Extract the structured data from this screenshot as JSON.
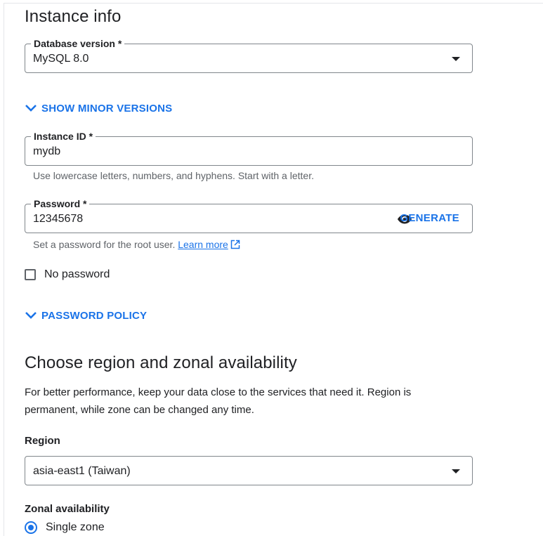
{
  "instance_info": {
    "title": "Instance info",
    "database_version": {
      "label": "Database version *",
      "value": "MySQL 8.0"
    },
    "show_minor_versions": "SHOW MINOR VERSIONS",
    "instance_id": {
      "label": "Instance ID *",
      "value": "mydb",
      "hint": "Use lowercase letters, numbers, and hyphens. Start with a letter."
    },
    "password": {
      "label": "Password *",
      "value": "12345678",
      "generate": "GENERATE",
      "hint": "Set a password for the root user.",
      "learn_more": "Learn more"
    },
    "no_password": {
      "label": "No password",
      "checked": false
    },
    "password_policy": "PASSWORD POLICY"
  },
  "region_section": {
    "title": "Choose region and zonal availability",
    "description": "For better performance, keep your data close to the services that need it. Region is permanent, while zone can be changed any time.",
    "region": {
      "label": "Region",
      "value": "asia-east1 (Taiwan)"
    },
    "zonal": {
      "label": "Zonal availability",
      "selected_option": "Single zone"
    }
  },
  "colors": {
    "accent": "#1a73e8",
    "text": "#202124",
    "secondary_text": "#5f6368",
    "border": "#80868b"
  },
  "icons": {
    "dropdown": "caret-down-icon",
    "expand": "chevron-down-icon",
    "visibility": "eye-icon",
    "external": "open-in-new-icon"
  }
}
